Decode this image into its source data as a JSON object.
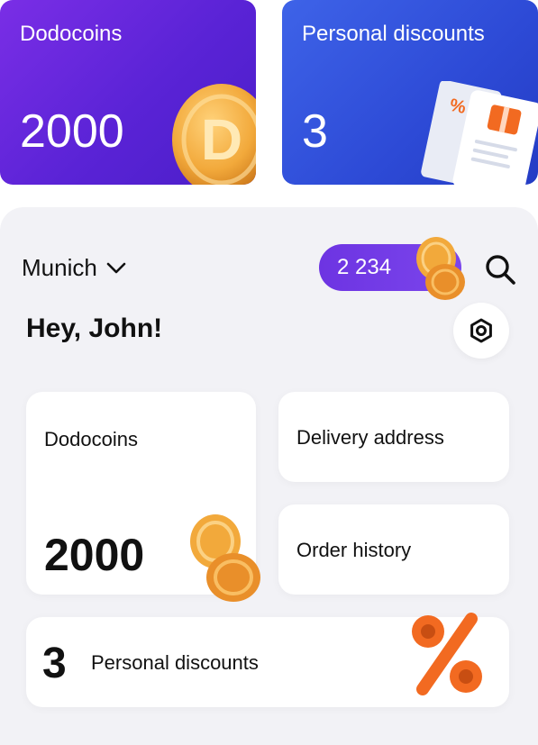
{
  "promo": {
    "dodocoins": {
      "title": "Dodocoins",
      "value": "2000"
    },
    "discounts": {
      "title": "Personal discounts",
      "value": "3"
    }
  },
  "header": {
    "city": "Munich",
    "balance": "2 234",
    "icons": {
      "dropdown": "chevron-down-icon",
      "search": "search-icon",
      "settings": "settings-icon"
    }
  },
  "greeting": "Hey, John!",
  "cards": {
    "dodocoins": {
      "label": "Dodocoins",
      "value": "2000"
    },
    "delivery": {
      "label": "Delivery address"
    },
    "history": {
      "label": "Order history"
    },
    "discounts": {
      "count": "3",
      "label": "Personal discounts"
    }
  },
  "colors": {
    "coins_card": "#5a23d6",
    "discounts_card": "#2d4ad6",
    "balance_pill": "#6d34e2",
    "app_bg": "#f2f2f6",
    "coin_gold": "#f2a93b",
    "percent_orange": "#f26a21"
  }
}
